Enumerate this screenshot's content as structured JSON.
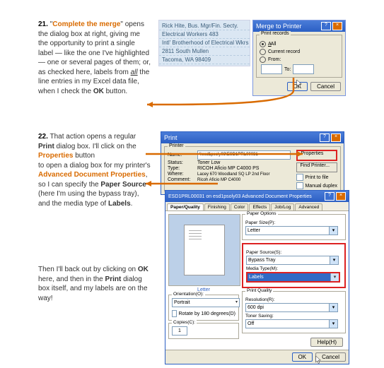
{
  "steps": {
    "s21": {
      "num": "21.",
      "quote_open": "\"",
      "title": "Complete the merge",
      "quote_close": "\"",
      "text1": "opens the dialog box at right, giving me the opportunity to print a single label — like the one I've highlighted — one or several pages of them; or, as checked here, labels from ",
      "all_word": "all",
      "text2": " the line entries in my Excel data file, when I check the ",
      "ok_word": "OK",
      "text3": " button."
    },
    "s22": {
      "num": "22.",
      "text1": "That action opens a regular ",
      "print_word": "Print",
      "text2": " dialog box.  I'll click on the ",
      "props_word": "Properties",
      "text3": " button",
      "text4": "to open a dialog box for my printer's ",
      "adp_word": "Advanced Document Properties",
      "text5": ",",
      "text6": "so I can specify the ",
      "paper_word": "Paper Source",
      "text7": " (here I'm using the bypass tray), and the media type of ",
      "labels_word": "Labels",
      "period": "."
    },
    "s23": {
      "text1": "Then I'll back out by clicking on ",
      "ok_word": "OK",
      "text2": " here, and then in the ",
      "print_word": "Print",
      "text3": " dialog box itself, and my labels are on the way!"
    }
  },
  "names_panel": {
    "r1": "Rick Hite, Bus. Mgr/Fin. Secty.",
    "r2": "Electrical Workers 483",
    "r3": "Intl' Brotherhood of Electrical Wkrs",
    "r4": "2811 South Mullen",
    "r5": "Tacoma, WA 98409"
  },
  "merge_dialog": {
    "title": "Merge to Printer",
    "group": "Print records",
    "opt_all": "All",
    "opt_current": "Current record",
    "opt_from": "From:",
    "to_label": "To:",
    "ok": "OK",
    "cancel": "Cancel"
  },
  "print_dialog": {
    "title": "Print",
    "printer_group": "Printer",
    "name_label": "Name:",
    "name_value": "\\\\esd1psoly03\\ESD1PRL00031",
    "status_label": "Status:",
    "status_value": "Toner Low",
    "type_label": "Type:",
    "type_value": "RICOH Aficio MP C4000 PS",
    "where_label": "Where:",
    "where_value": "Lacey 670 Woodland SQ LP 2nd Floor",
    "comment_label": "Comment:",
    "comment_value": "Ricoh Aficio MP C4000",
    "properties_btn": "Properties",
    "find_btn": "Find Printer...",
    "print_to_file": "Print to file",
    "manual_duplex": "Manual duplex"
  },
  "adp_dialog": {
    "title": "ESD1PRL00031 on esd1psoly03 Advanced Document Properties",
    "tabs": {
      "t1": "Paper/Quality",
      "t2": "Finishing",
      "t3": "Color",
      "t4": "Effects",
      "t5": "Job/Log",
      "t6": "Advanced"
    },
    "preview_label": "Letter",
    "orientation_group": "Orientation(O):",
    "orientation_value": "Portrait",
    "rotate_label": "Rotate by 180 degrees(D)",
    "copies_group": "Copies(C):",
    "copies_value": "1",
    "paper_options_group": "Paper Options",
    "paper_size_label": "Paper Size(P):",
    "paper_size_value": "Letter",
    "paper_source_label": "Paper Source(S):",
    "paper_source_value": "Bypass Tray",
    "media_type_label": "Media Type(M):",
    "media_type_value": "Labels",
    "print_quality_group": "Print Quality",
    "resolution_label": "Resolution(R):",
    "resolution_value": "600 dpi",
    "toner_label": "Toner Saving:",
    "toner_value": "Off",
    "help_btn": "Help(H)",
    "ok": "OK",
    "cancel": "Cancel"
  }
}
